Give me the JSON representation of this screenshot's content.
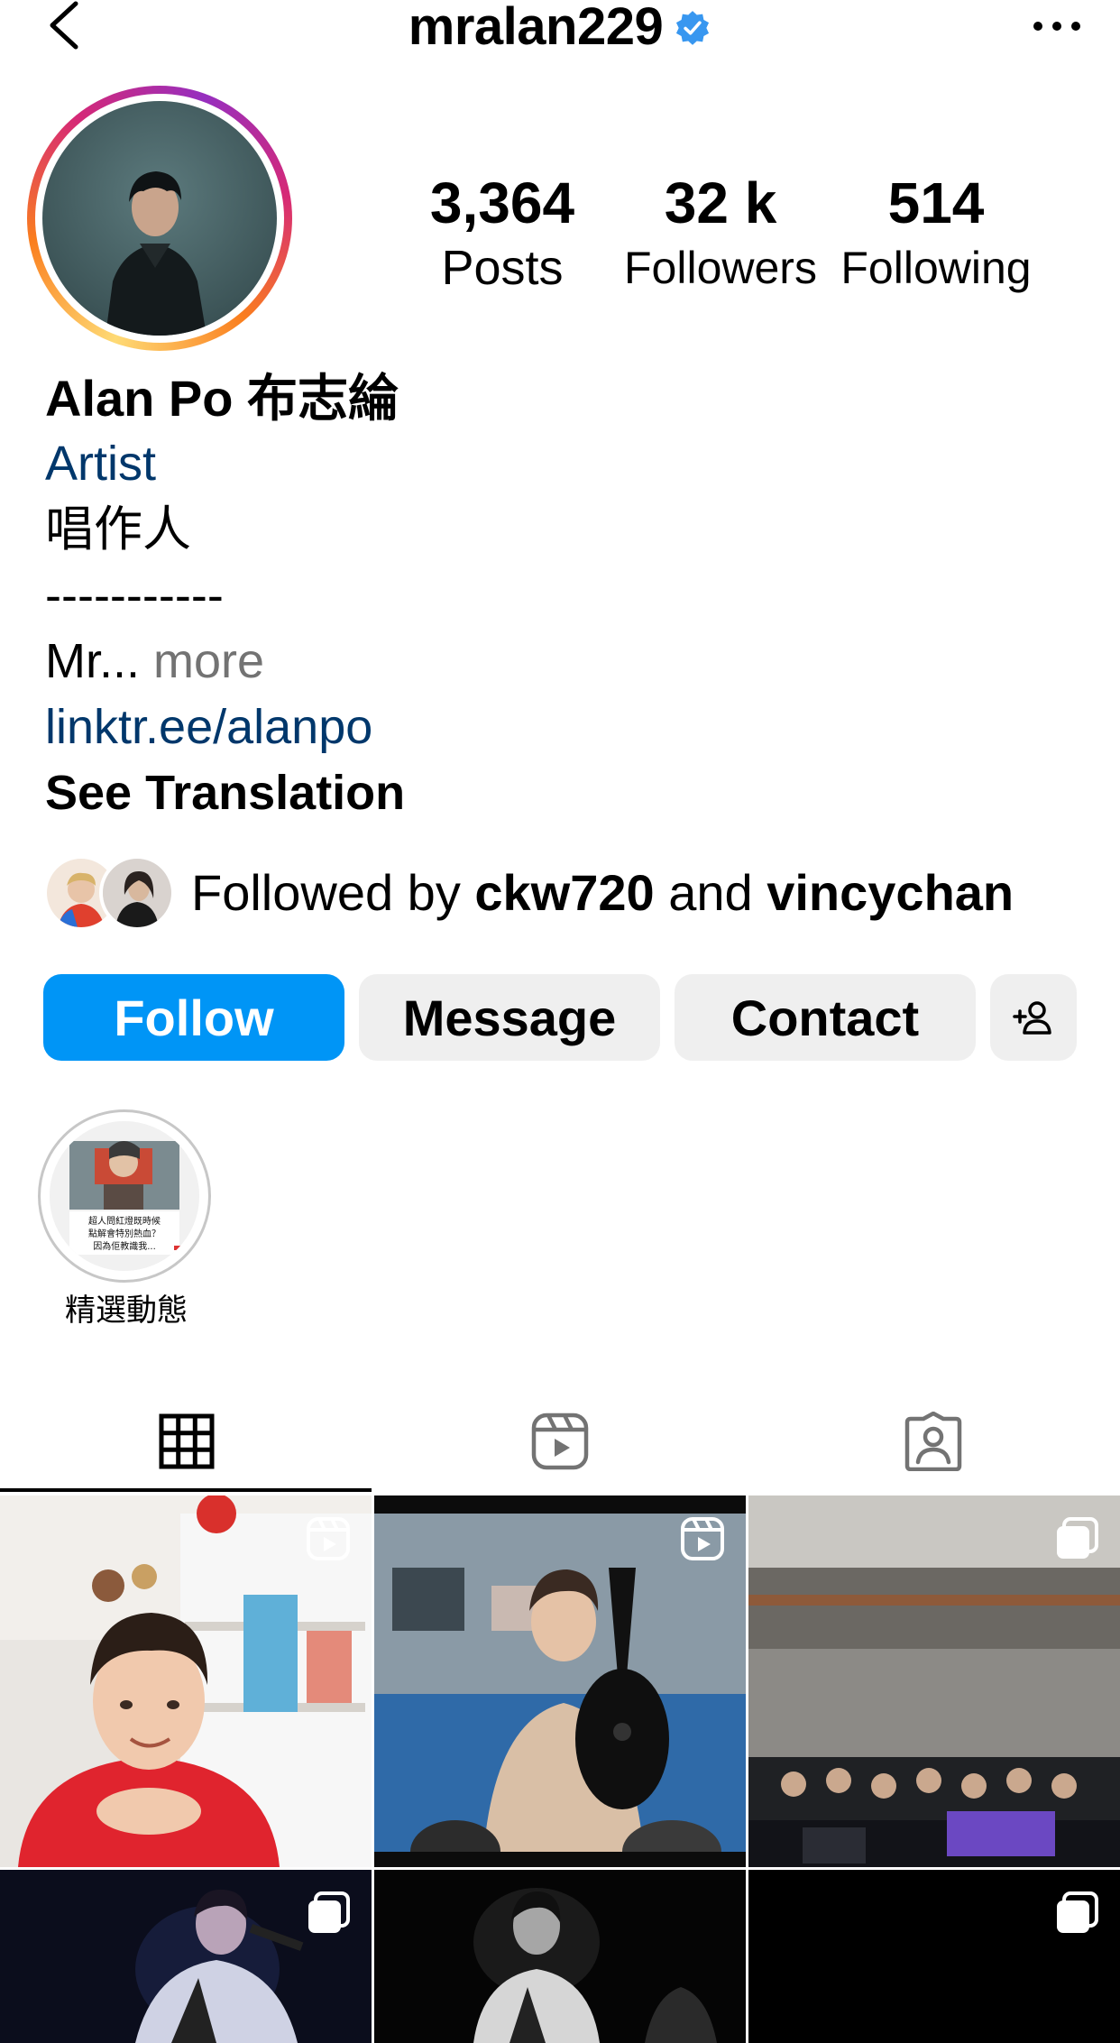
{
  "header": {
    "username": "mralan229",
    "back_icon": "chevron-left-icon",
    "verified_icon": "verified-badge-icon",
    "more_icon": "ellipsis-icon"
  },
  "stats": {
    "posts": {
      "value": "3,364",
      "label": "Posts"
    },
    "followers": {
      "value": "32 k",
      "label": "Followers"
    },
    "following": {
      "value": "514",
      "label": "Following"
    }
  },
  "bio": {
    "name": "Alan Po 布志綸",
    "category": "Artist",
    "line1": "唱作人",
    "line2": "-----------",
    "truncated": "Mr...",
    "more_label": " more",
    "link": "linktr.ee/alanpo",
    "translation_label": "See Translation"
  },
  "followed_by": {
    "prefix": "Followed by ",
    "user1": "ckw720",
    "connector": " and ",
    "user2": "vincychan"
  },
  "buttons": {
    "follow": "Follow",
    "message": "Message",
    "contact": "Contact",
    "suggest_icon": "add-person-icon"
  },
  "highlights": [
    {
      "label": "精選動態",
      "image_text": "超人問紅燈既時候\n點解會特別熱血？\n因為佢教識我..."
    }
  ],
  "tabs": [
    {
      "name": "posts",
      "icon": "grid-icon",
      "active": true
    },
    {
      "name": "reels",
      "icon": "reels-icon",
      "active": false
    },
    {
      "name": "tagged",
      "icon": "tagged-person-icon",
      "active": false
    }
  ],
  "colors": {
    "accent_blue": "#0095f6",
    "link_blue": "#00376b",
    "verified_blue": "#3897f0",
    "button_gray": "#efefef",
    "muted_text": "#737373"
  },
  "grid_posts": [
    {
      "type": "reel",
      "badge_icon": "reel-badge-icon"
    },
    {
      "type": "reel",
      "badge_icon": "reel-badge-icon"
    },
    {
      "type": "carousel",
      "badge_icon": "carousel-badge-icon"
    },
    {
      "type": "carousel",
      "badge_icon": "carousel-badge-icon"
    },
    {
      "type": "photo",
      "badge_icon": ""
    },
    {
      "type": "carousel",
      "badge_icon": "carousel-badge-icon"
    }
  ]
}
